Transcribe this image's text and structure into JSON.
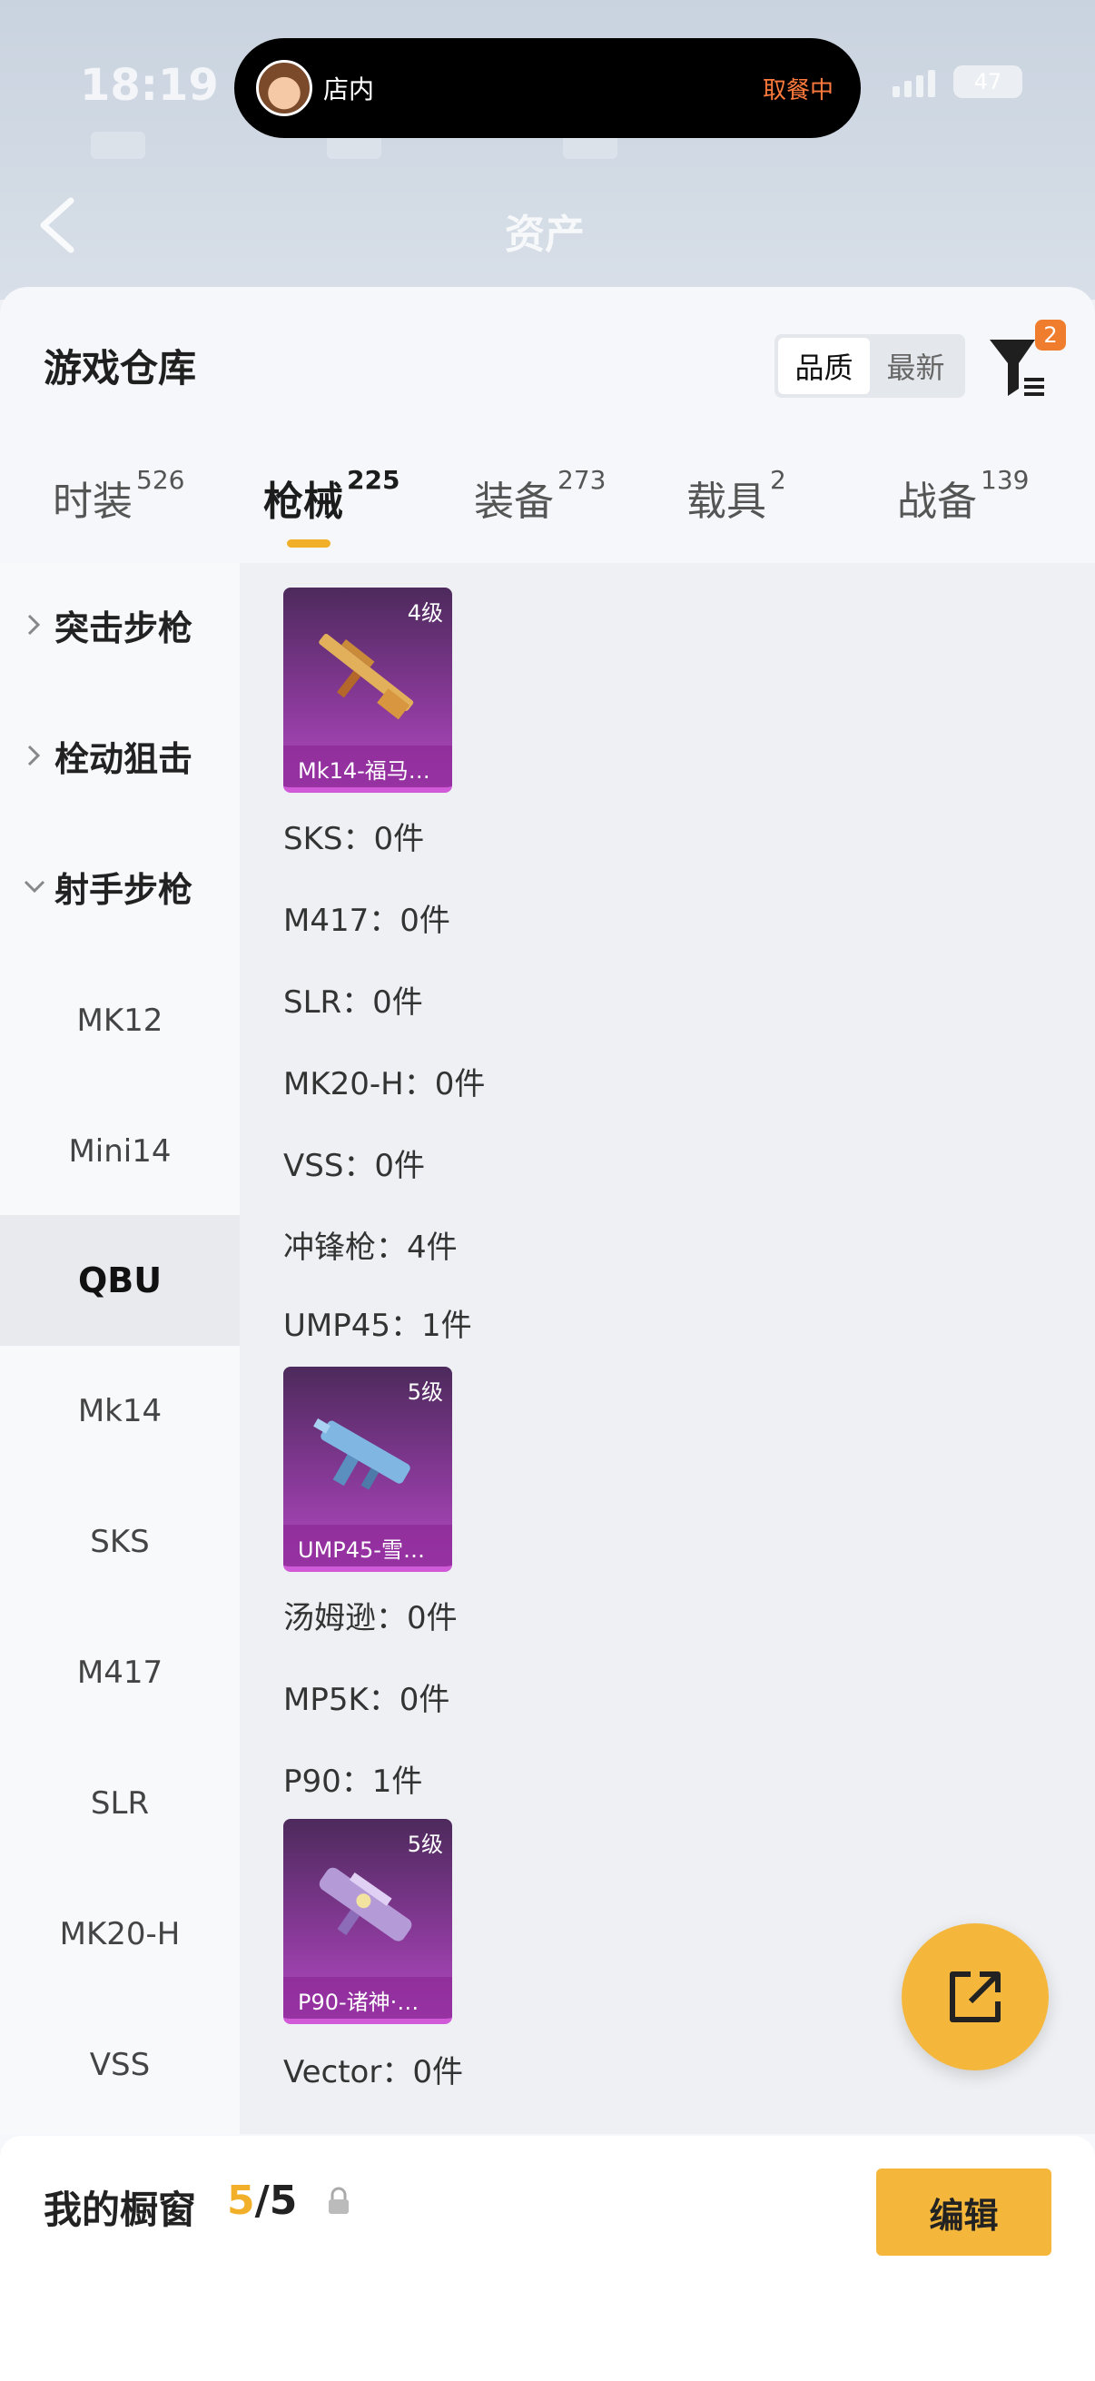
{
  "status": {
    "time": "18:19",
    "battery": "47"
  },
  "island": {
    "left_text": "店内",
    "right_text": "取餐中"
  },
  "nav": {
    "title": "资产"
  },
  "sheet": {
    "title": "游戏仓库",
    "sort": {
      "options": [
        "品质",
        "最新"
      ],
      "selected": "品质"
    },
    "filter_badge": "2"
  },
  "tabs": [
    {
      "label": "时装",
      "count": "526"
    },
    {
      "label": "枪械",
      "count": "225"
    },
    {
      "label": "装备",
      "count": "273"
    },
    {
      "label": "载具",
      "count": "2"
    },
    {
      "label": "战备",
      "count": "139"
    }
  ],
  "sidebar": {
    "categories": [
      {
        "label": "突击步枪",
        "expanded": false
      },
      {
        "label": "栓动狙击",
        "expanded": false
      },
      {
        "label": "射手步枪",
        "expanded": true
      }
    ],
    "items": [
      "MK12",
      "Mini14",
      "QBU",
      "Mk14",
      "SKS",
      "M417",
      "SLR",
      "MK20-H",
      "VSS"
    ],
    "active_item": "QBU"
  },
  "content": {
    "cards": [
      {
        "level": "4级",
        "name": "Mk14-福马…"
      },
      {
        "level": "5级",
        "name": "UMP45-雪…"
      },
      {
        "level": "5级",
        "name": "P90-诸神·…"
      }
    ],
    "lines": [
      "SKS：0件",
      "M417：0件",
      "SLR：0件",
      "MK20-H：0件",
      "VSS：0件",
      "冲锋枪：4件",
      "UMP45：1件",
      "汤姆逊：0件",
      "MP5K：0件",
      "P90：1件",
      "Vector：0件"
    ]
  },
  "bottom": {
    "title": "我的橱窗",
    "count_current": "5",
    "count_total": "/5",
    "edit_label": "编辑"
  },
  "colors": {
    "accent": "#f5b73b",
    "badge": "#f07c2e",
    "card_purple": "#8a3a9a"
  }
}
